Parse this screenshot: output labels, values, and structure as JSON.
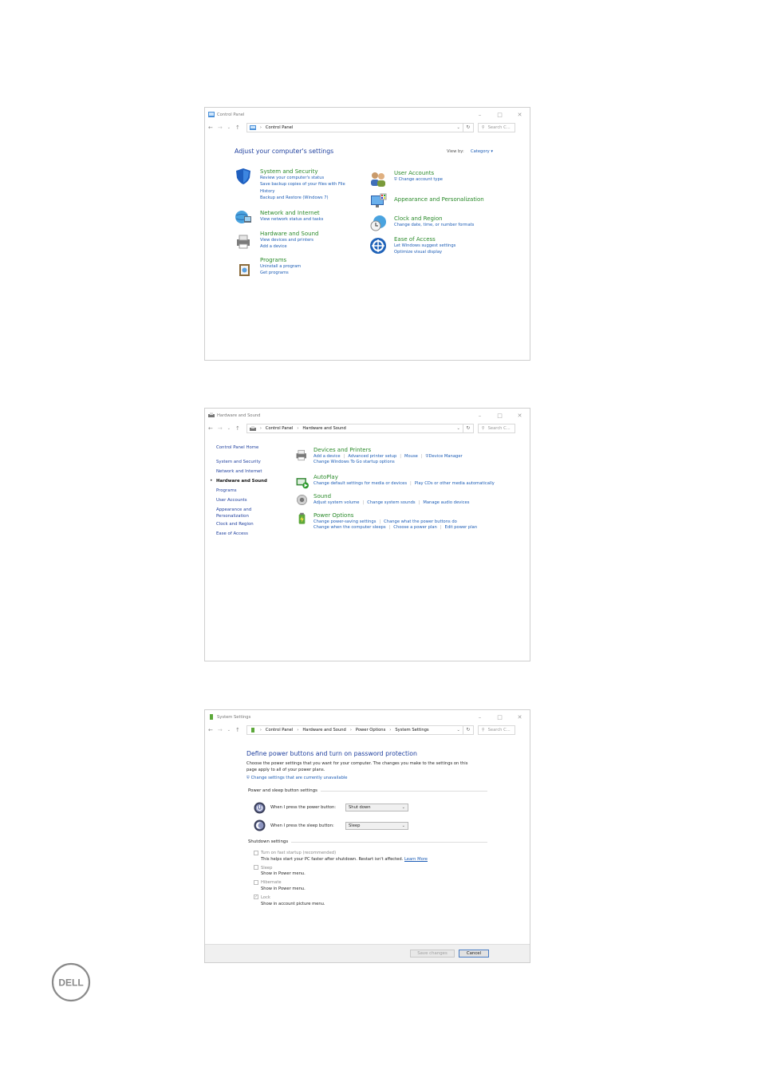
{
  "window1": {
    "title": "Control Panel",
    "path": [
      "Control Panel"
    ],
    "search": "Search C...",
    "heading": "Adjust your computer's settings",
    "viewby_label": "View by:",
    "viewby_value": "Category",
    "categories": [
      {
        "title": "System and Security",
        "links": [
          "Review your computer's status",
          "Save backup copies of your files with File",
          "History",
          "Backup and Restore (Windows 7)"
        ]
      },
      {
        "title": "Network and Internet",
        "links": [
          "View network status and tasks"
        ]
      },
      {
        "title": "Hardware and Sound",
        "links": [
          "View devices and printers",
          "Add a device"
        ]
      },
      {
        "title": "Programs",
        "links": [
          "Uninstall a program",
          "Get programs"
        ]
      },
      {
        "title": "User Accounts",
        "links": [
          "Change account type"
        ]
      },
      {
        "title": "Appearance and Personalization",
        "links": []
      },
      {
        "title": "Clock and Region",
        "links": [
          "Change date, time, or number formats"
        ]
      },
      {
        "title": "Ease of Access",
        "links": [
          "Let Windows suggest settings",
          "Optimize visual display"
        ]
      }
    ]
  },
  "window2": {
    "title": "Hardware and Sound",
    "path": [
      "Control Panel",
      "Hardware and Sound"
    ],
    "search": "Search C...",
    "sidebar": [
      "Control Panel Home",
      "System and Security",
      "Network and Internet",
      "Hardware and Sound",
      "Programs",
      "User Accounts",
      "Appearance and",
      "Personalization",
      "Clock and Region",
      "Ease of Access"
    ],
    "sections": [
      {
        "title": "Devices and Printers",
        "row1": [
          "Add a device",
          "Advanced printer setup",
          "Mouse",
          "Device Manager"
        ],
        "row2": [
          "Change Windows To Go startup options"
        ]
      },
      {
        "title": "AutoPlay",
        "row1": [
          "Change default settings for media or devices",
          "Play CDs or other media automatically"
        ]
      },
      {
        "title": "Sound",
        "row1": [
          "Adjust system volume",
          "Change system sounds",
          "Manage audio devices"
        ]
      },
      {
        "title": "Power Options",
        "row1": [
          "Change power-saving settings",
          "Change what the power buttons do"
        ],
        "row2": [
          "Change when the computer sleeps",
          "Choose a power plan",
          "Edit power plan"
        ]
      }
    ]
  },
  "window3": {
    "title": "System Settings",
    "path": [
      "Control Panel",
      "Hardware and Sound",
      "Power Options",
      "System Settings"
    ],
    "search": "Search C...",
    "heading": "Define power buttons and turn on password protection",
    "desc1": "Choose the power settings that you want for your computer. The changes you make to the settings on this",
    "desc2": "page apply to all of your power plans.",
    "change_link": "Change settings that are currently unavailable",
    "power_section": "Power and sleep button settings",
    "power_label": "When I press the power button:",
    "power_value": "Shut down",
    "sleep_label": "When I press the sleep button:",
    "sleep_value": "Sleep",
    "shutdown_section": "Shutdown settings",
    "opts": [
      {
        "label": "Turn on fast startup (recommended)",
        "desc": "This helps start your PC faster after shutdown. Restart isn't affected.",
        "link": "Learn More"
      },
      {
        "label": "Sleep",
        "desc": "Show in Power menu."
      },
      {
        "label": "Hibernate",
        "desc": "Show in Power menu."
      },
      {
        "label": "Lock",
        "desc": "Show in account picture menu."
      }
    ],
    "save": "Save changes",
    "cancel": "Cancel"
  },
  "logo": {
    "text": "DELL"
  }
}
